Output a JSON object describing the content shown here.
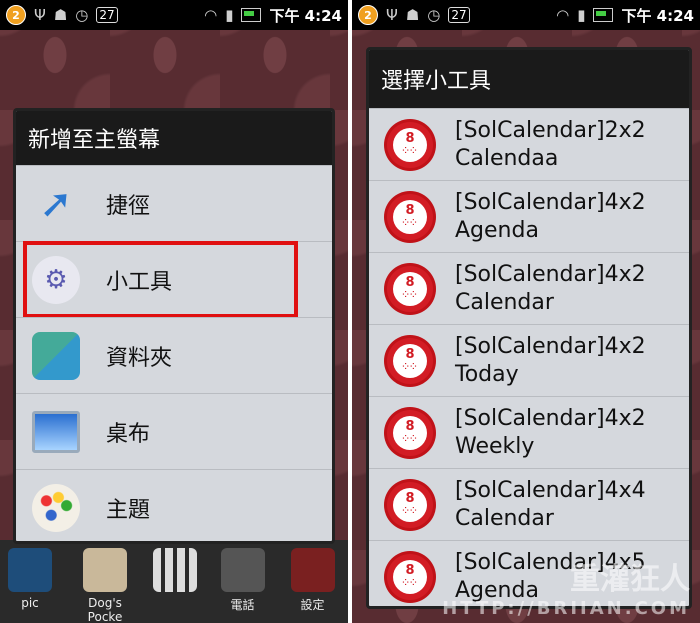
{
  "status_bar": {
    "notification_count": "2",
    "calendar_day": "27",
    "time": "下午 4:24"
  },
  "left_screen": {
    "dialog_title": "新增至主螢幕",
    "items": [
      {
        "label": "捷徑",
        "icon": "shortcut-arrow-icon"
      },
      {
        "label": "小工具",
        "icon": "widget-gear-icon"
      },
      {
        "label": "資料夾",
        "icon": "folder-icon"
      },
      {
        "label": "桌布",
        "icon": "wallpaper-icon"
      },
      {
        "label": "主題",
        "icon": "theme-palette-icon"
      }
    ],
    "dock": [
      {
        "label": "pic"
      },
      {
        "label": "Dog's Pocke"
      },
      {
        "label": ""
      },
      {
        "label": "電話"
      },
      {
        "label": "設定"
      }
    ]
  },
  "right_screen": {
    "dialog_title": "選擇小工具",
    "widgets": [
      {
        "line1": "[SolCalendar]2x2",
        "line2": "Calendaa"
      },
      {
        "line1": "[SolCalendar]4x2",
        "line2": "Agenda"
      },
      {
        "line1": "[SolCalendar]4x2",
        "line2": "Calendar"
      },
      {
        "line1": "[SolCalendar]4x2",
        "line2": "Today"
      },
      {
        "line1": "[SolCalendar]4x2",
        "line2": "Weekly"
      },
      {
        "line1": "[SolCalendar]4x4",
        "line2": "Calendar"
      },
      {
        "line1": "[SolCalendar]4x5",
        "line2": "Agenda"
      }
    ],
    "watermark": "重灌狂人",
    "watermark_url": "HTTP://BRIIAN.COM"
  },
  "colors": {
    "highlight": "#e01010",
    "dialog_bg": "#d5d8dd",
    "title_bg": "#1a1a1a",
    "sol_red": "#d21c24"
  }
}
